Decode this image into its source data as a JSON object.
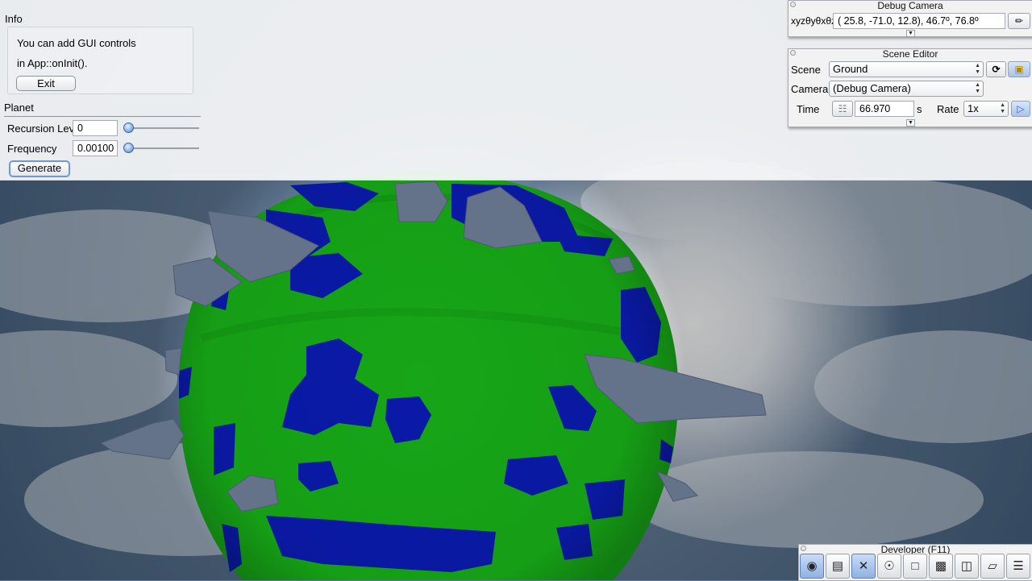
{
  "info_panel": {
    "title": "Info",
    "line1": "You can add GUI controls",
    "line2": "in App::onInit().",
    "exit_label": "Exit"
  },
  "planet_panel": {
    "title": "Planet",
    "recursion_label": "Recursion Level",
    "recursion_value": "0",
    "recursion_slider": 0,
    "frequency_label": "Frequency",
    "frequency_value": "0.00100",
    "frequency_slider": 0,
    "generate_label": "Generate"
  },
  "debug_camera": {
    "title": "Debug Camera",
    "coord_label": "xyzθyθxθz",
    "coord_value": "( 25.8, -71.0,  12.8),  46.7º,  76.8º"
  },
  "scene_editor": {
    "title": "Scene Editor",
    "scene_label": "Scene",
    "scene_value": "Ground",
    "camera_label": "Camera",
    "camera_value": "(Debug Camera)",
    "time_label": "Time",
    "time_value": "66.970",
    "time_unit": "s",
    "rate_label": "Rate",
    "rate_value": "1x"
  },
  "developer": {
    "title": "Developer (F11)",
    "tools": [
      {
        "icon": "camera-icon"
      },
      {
        "icon": "clapperboard-icon"
      },
      {
        "icon": "wrench-icon"
      },
      {
        "icon": "compass-icon"
      },
      {
        "icon": "new-window-icon"
      },
      {
        "icon": "console-icon"
      },
      {
        "icon": "scene-graph-icon"
      },
      {
        "icon": "profiler-icon"
      },
      {
        "icon": "log-icon"
      }
    ]
  },
  "colors": {
    "land": "#17a617",
    "ocean": "#0a1aa8",
    "rock": "#64738a",
    "sky": "#5d7894",
    "accent": "#6e98d2"
  }
}
